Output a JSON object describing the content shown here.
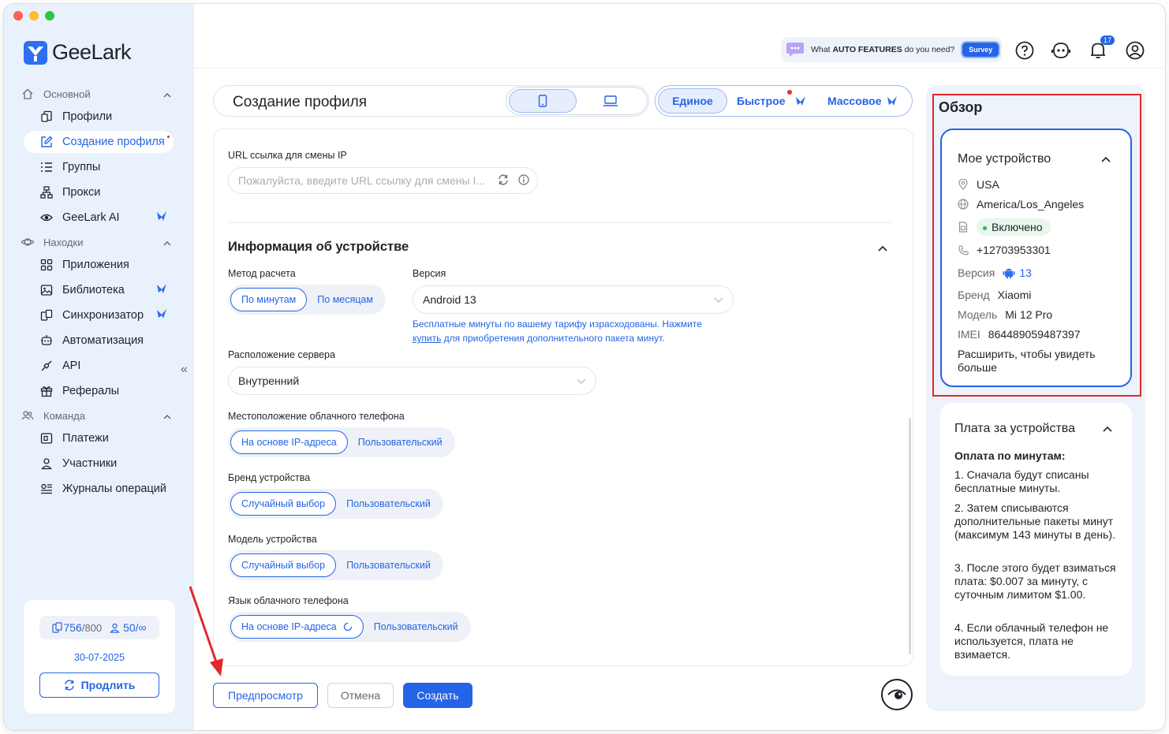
{
  "brand": {
    "name": "GeeLark"
  },
  "sidebar": {
    "sections": [
      {
        "label": "Основной"
      },
      {
        "label": "Находки"
      },
      {
        "label": "Команда"
      }
    ],
    "items": [
      {
        "label": "Профили"
      },
      {
        "label": "Создание профиля"
      },
      {
        "label": "Группы"
      },
      {
        "label": "Прокси"
      },
      {
        "label": "GeeLark AI"
      },
      {
        "label": "Приложения"
      },
      {
        "label": "Библиотека"
      },
      {
        "label": "Синхронизатор"
      },
      {
        "label": "Автоматизация"
      },
      {
        "label": "API"
      },
      {
        "label": "Рефералы"
      },
      {
        "label": "Платежи"
      },
      {
        "label": "Участники"
      },
      {
        "label": "Журналы операций"
      }
    ],
    "active_item": "Создание профиля",
    "plan": {
      "devices_used": "756",
      "devices_total": "/800",
      "members_used": "50",
      "members_total": "/∞",
      "expiry": "30-07-2025",
      "renew_label": "Продлить"
    }
  },
  "topbar": {
    "survey_prefix": "What ",
    "survey_bold": "AUTO FEATURES",
    "survey_suffix": " do you need?",
    "survey_button": "Survey",
    "notification_count": "17",
    "icons": [
      "help-icon",
      "support-bot-icon",
      "bell-icon",
      "user-icon"
    ]
  },
  "header": {
    "title": "Создание профиля",
    "modes": [
      "Единое",
      "Быстрое",
      "Массовое"
    ],
    "selected_mode": "Единое",
    "device_types": [
      "phone-icon",
      "laptop-icon"
    ],
    "selected_device_type": "phone-icon"
  },
  "form": {
    "url_label": "URL ссылка для смены IP",
    "url_placeholder": "Пожалуйста, введите URL ссылку для смены I...",
    "device_info_title": "Информация об устройстве",
    "billing_label": "Метод расчета",
    "billing_options": [
      "По минутам",
      "По месяцам"
    ],
    "version_label": "Версия",
    "version_value": "Android 13",
    "notice_part1": "Бесплатные минуты по вашему тарифу израсходованы. Нажмите",
    "notice_link": "купить",
    "notice_part2": " для приобретения дополнительного пакета минут.",
    "server_label": "Расположение сервера",
    "server_value": "Внутренний",
    "location_label": "Местоположение облачного телефона",
    "location_options": [
      "На основе IP-адреса",
      "Пользовательский"
    ],
    "brand_label": "Бренд устройства",
    "brand_options": [
      "Случайный выбор",
      "Пользовательский"
    ],
    "model_label": "Модель устройства",
    "model_options": [
      "Случайный выбор",
      "Пользовательский"
    ],
    "language_label": "Язык облачного телефона",
    "language_options": [
      "На основе IP-адреса",
      "Пользовательский"
    ]
  },
  "actions": {
    "preview": "Предпросмотр",
    "cancel": "Отмена",
    "create": "Создать"
  },
  "overview": {
    "title": "Обзор",
    "device": {
      "title": "Мое устройство",
      "country": "USA",
      "timezone": "America/Los_Angeles",
      "sim_status": "Включено",
      "phone": "+12703953301",
      "version_key": "Версия",
      "version_value": "13",
      "brand_key": "Бренд",
      "brand_value": "Xiaomi",
      "model_key": "Модель",
      "model_value": "Mi 12 Pro",
      "imei_key": "IMEI",
      "imei_value": "864489059487397",
      "expand": "Расширить, чтобы увидеть больше"
    },
    "fees": {
      "title": "Плата за устройства",
      "subtitle": "Оплата по минутам:",
      "items": [
        "1. Сначала будут списаны бесплатные минуты.",
        "2. Затем списываются дополнительные пакеты минут (максимум 143 минуты в день).",
        "3. После этого будет взиматься плата: $0.007 за минуту, с суточным лимитом $1.00.",
        "4. Если облачный телефон не используется, плата не взимается."
      ]
    }
  },
  "colors": {
    "accent": "#2464e6",
    "sidebar_bg": "#e9f1fc",
    "highlight_red": "#e3272c"
  }
}
